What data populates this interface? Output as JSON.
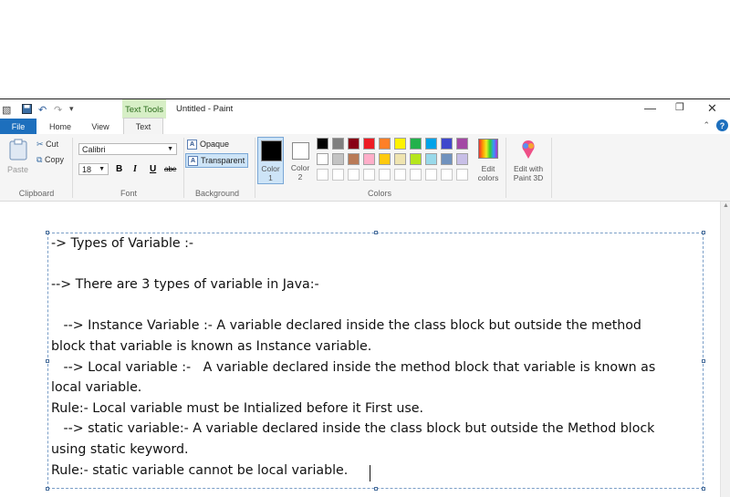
{
  "window": {
    "title": "Untitled - Paint",
    "context_tab": "Text Tools"
  },
  "tabs": [
    "File",
    "Home",
    "View",
    "Text"
  ],
  "ribbon": {
    "clipboard": {
      "paste": "Paste",
      "cut": "Cut",
      "copy": "Copy",
      "label": "Clipboard"
    },
    "font": {
      "family": "Calibri",
      "size": "18",
      "bold": "B",
      "italic": "I",
      "underline": "U",
      "strike": "abe",
      "label": "Font"
    },
    "background": {
      "opaque": "Opaque",
      "transparent": "Transparent",
      "label": "Background"
    },
    "colors": {
      "color1": "Color 1",
      "color1_top": "Color",
      "color1_bottom": "1",
      "color2_top": "Color",
      "color2_bottom": "2",
      "edit_colors_top": "Edit",
      "edit_colors_bottom": "colors",
      "paint3d_top": "Edit with",
      "paint3d_bottom": "Paint 3D",
      "label": "Colors",
      "palette_row1": [
        "#000000",
        "#7f7f7f",
        "#880015",
        "#ed1c24",
        "#ff7f27",
        "#fff200",
        "#22b14c",
        "#00a2e8",
        "#3f48cc",
        "#a349a4"
      ],
      "palette_row2": [
        "#ffffff",
        "#c3c3c3",
        "#b97a57",
        "#ffaec9",
        "#ffc90e",
        "#efe4b0",
        "#b5e61d",
        "#99d9ea",
        "#7092be",
        "#c8bfe7"
      ]
    }
  },
  "text_lines": [
    "-> Types of Variable :-",
    "",
    "--> There are 3 types of variable in Java:-",
    "",
    "   --> Instance Variable :- A variable declared inside the class block but outside the method",
    "block that variable is known as Instance variable.",
    "   --> Local variable :-   A variable declared inside the method block that variable is known as",
    "local variable.",
    "Rule:- Local variable must be Intialized before it First use.",
    "   --> static variable:- A variable declared inside the class block but outside the Method block",
    "using static keyword.",
    "Rule:- static variable cannot be local variable."
  ]
}
